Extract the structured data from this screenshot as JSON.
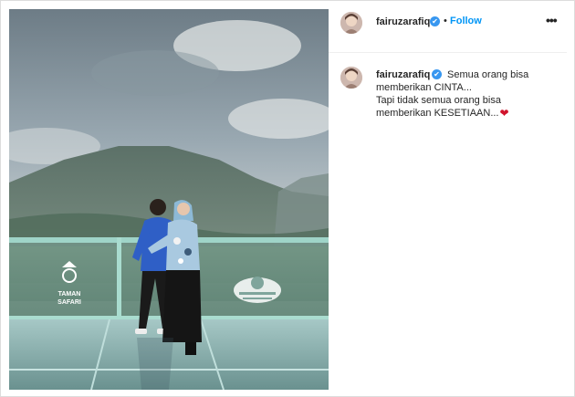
{
  "post": {
    "username": "fairuzarafiq",
    "verified_mark": "✔",
    "separator": "•",
    "follow_label": "Follow",
    "more_icon": "•••"
  },
  "caption": {
    "username": "fairuzarafiq",
    "line1": "Semua orang bisa",
    "line2": "memberikan CINTA...",
    "line3": "Tapi tidak semua orang bisa",
    "line4": "memberikan KESETIAAN...",
    "emoji": "❤"
  },
  "photo": {
    "sign_left_line1": "TAMAN",
    "sign_left_line2": "SAFARI"
  },
  "colors": {
    "accent": "#0095f6",
    "verified": "#3897f0",
    "heart": "#d0142c"
  }
}
